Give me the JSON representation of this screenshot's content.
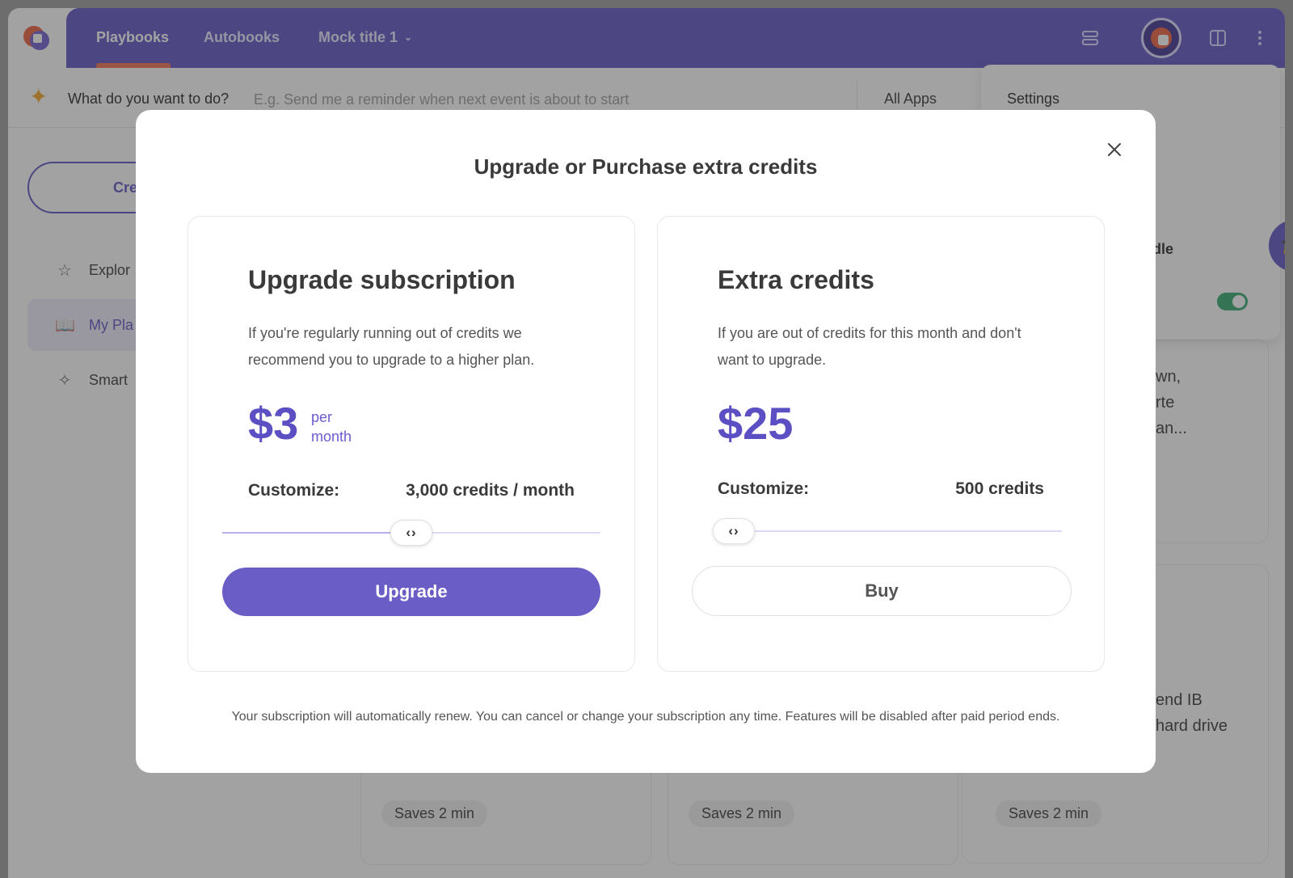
{
  "nav": {
    "tabs": [
      {
        "label": "Playbooks"
      },
      {
        "label": "Autobooks"
      },
      {
        "label": "Mock title 1"
      }
    ]
  },
  "ask": {
    "label": "What do you want to do?",
    "placeholder": "E.g. Send me a reminder when next event is about to start",
    "apps_select": "All Apps"
  },
  "sidebar": {
    "create_label": "Cre",
    "items": [
      {
        "label": "Explor",
        "icon": "star-icon"
      },
      {
        "label": "My Pla",
        "icon": "book-icon"
      },
      {
        "label": "Smart",
        "icon": "sparkle-icon"
      }
    ]
  },
  "dropdown": {
    "settings_label": "Settings",
    "partial_item": "dle"
  },
  "background_cards": {
    "partial_text_1": [
      "wn,",
      "rte",
      "an..."
    ],
    "partial_text_2": [
      "end IB",
      "hard drive"
    ],
    "saves": [
      "Saves 2 min",
      "Saves 2 min",
      "Saves 2 min"
    ]
  },
  "modal": {
    "title": "Upgrade or Purchase extra credits",
    "footer": "Your subscription will automatically renew. You can cancel or change your subscription any time. Features will be disabled after paid period ends.",
    "upgrade": {
      "title": "Upgrade subscription",
      "description": "If you're regularly running out of credits we recommend you to upgrade to a higher plan.",
      "price": "$3",
      "price_unit": "per month",
      "customize_label": "Customize:",
      "customize_value": "3,000 credits / month",
      "slider_level": 0.5,
      "button": "Upgrade"
    },
    "extra": {
      "title": "Extra credits",
      "description": "If you are out of credits for this month and don't want to upgrade.",
      "price": "$25",
      "customize_label": "Customize:",
      "customize_value": "500 credits",
      "slider_level": 0.0,
      "button": "Buy"
    },
    "slider_glyph": "‹›"
  },
  "colors": {
    "accent": "#5b4fc3",
    "button": "#6a5ec6",
    "toggle_on": "#2fa86a",
    "tab_underline": "#f26b4a"
  }
}
